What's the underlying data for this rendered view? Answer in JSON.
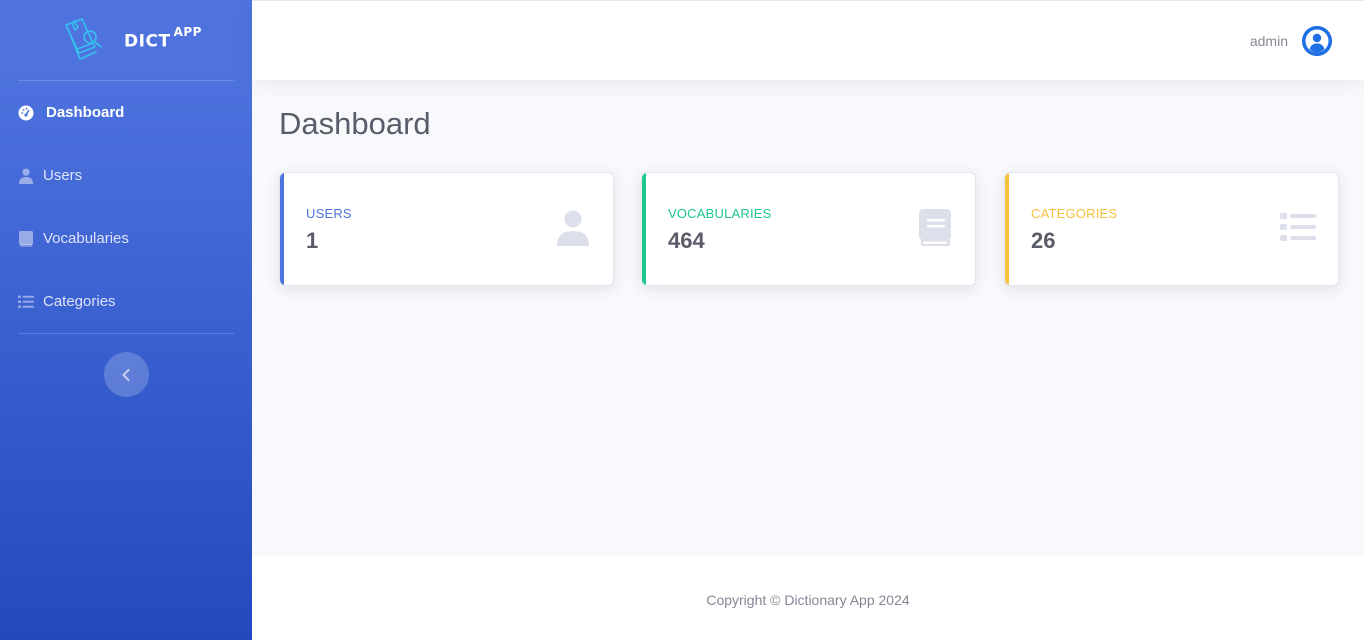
{
  "brand": {
    "name": "DICT",
    "sup": "APP"
  },
  "sidebar": {
    "items": [
      {
        "label": "Dashboard",
        "icon": "tachometer-icon",
        "active": true
      },
      {
        "label": "Users",
        "icon": "user-icon",
        "active": false
      },
      {
        "label": "Vocabularies",
        "icon": "book-icon",
        "active": false
      },
      {
        "label": "Categories",
        "icon": "list-icon",
        "active": false
      }
    ],
    "toggle_icon": "chevron-left-icon"
  },
  "topbar": {
    "user_name": "admin",
    "avatar_icon": "user-circle-icon"
  },
  "page": {
    "title": "Dashboard"
  },
  "cards": [
    {
      "label": "USERS",
      "value": "1",
      "accent": "#4e73df",
      "icon": "user-icon"
    },
    {
      "label": "VOCABULARIES",
      "value": "464",
      "accent": "#1cc88a",
      "icon": "book-icon"
    },
    {
      "label": "CATEGORIES",
      "value": "26",
      "accent": "#f6c23e",
      "icon": "list-icon"
    }
  ],
  "footer": {
    "copyright": "Copyright © Dictionary App 2024"
  },
  "colors": {
    "sidebar_gradient_start": "#4e73df",
    "sidebar_gradient_end": "#224abe",
    "text_gray": "#5a5c69",
    "muted_gray": "#858796",
    "icon_gray": "#dddfeb",
    "avatar_blue": "#1f6fe5"
  }
}
